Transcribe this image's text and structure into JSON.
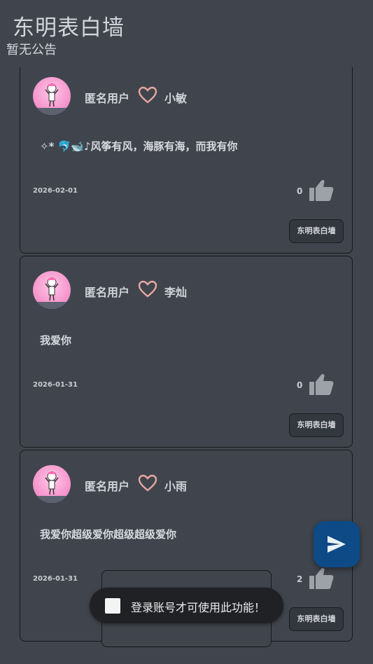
{
  "header": {
    "title": "东明表白墙",
    "notice": "暂无公告"
  },
  "posts": [
    {
      "sender": "匿名用户",
      "receiver": "小敏",
      "content": "✧* 🐬🐋♪风筝有风，海豚有海，而我有你",
      "date": "2026-02-01",
      "likes": "0",
      "wall_label": "东明表白墙"
    },
    {
      "sender": "匿名用户",
      "receiver": "李灿",
      "content": "我爱你",
      "date": "2026-01-31",
      "likes": "0",
      "wall_label": "东明表白墙"
    },
    {
      "sender": "匿名用户",
      "receiver": "小雨",
      "content": "我爱你超级爱你超级超级爱你",
      "date": "2026-01-31",
      "likes": "2",
      "wall_label": "东明表白墙"
    }
  ],
  "toast": {
    "message": "登录账号才可使用此功能！"
  },
  "icons": {
    "heart": "heart-outline-icon",
    "like": "thumb-up-icon",
    "send": "send-icon"
  },
  "colors": {
    "background": "#40454d",
    "fab": "#0d4a86",
    "heart_stroke": "#e7a7a0"
  }
}
